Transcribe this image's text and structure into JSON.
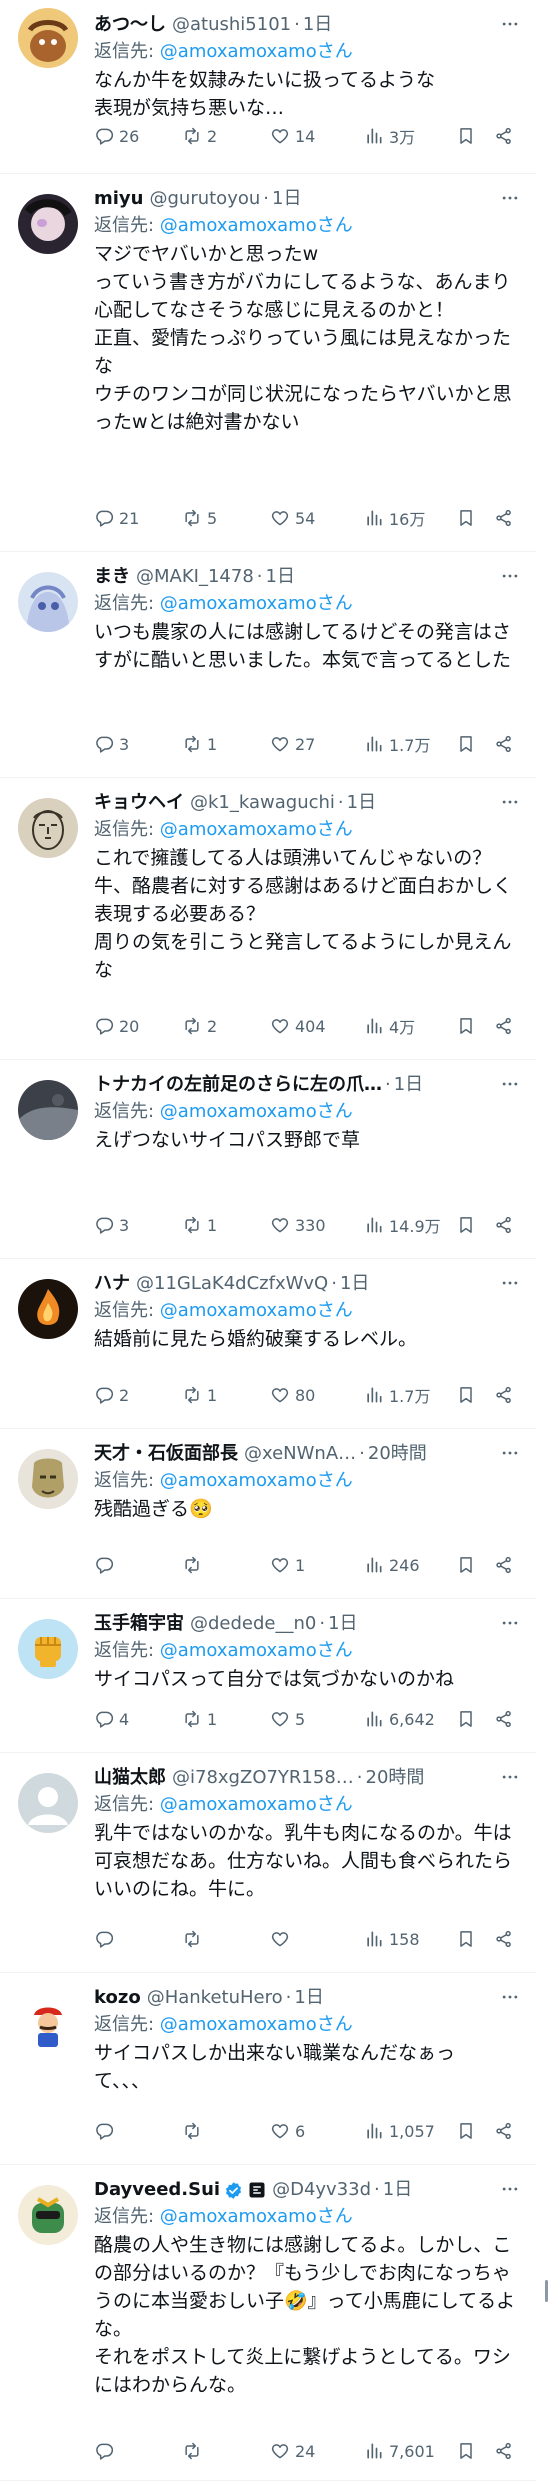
{
  "reply_prefix": "返信先: ",
  "reply_suffix": "さん",
  "tweets": [
    {
      "name": "あつ〜し",
      "handle": "@atushi5101",
      "time": "1日",
      "reply_to": "@amoxamoxamo",
      "text": "なんか牛を奴隷みたいに扱ってるような\n表現が気持ち悪いな…",
      "replies": "26",
      "retweets": "2",
      "likes": "14",
      "views": "3万",
      "avatar": {
        "kind": "illustration",
        "bg": "#f0c87a",
        "fg": "#a8642c"
      }
    },
    {
      "name": "miyu",
      "handle": "@gurutoyou",
      "time": "1日",
      "reply_to": "@amoxamoxamo",
      "text": "マジでヤバいかと思ったw\nっていう書き方がバカにしてるような、あんまり心配してなさそうな感じに見えるのかと！\n正直、愛情たっぷりっていう風には見えなかったな\nウチのワンコが同じ状況になったらヤバいかと思ったwとは絶対書かない",
      "replies": "21",
      "retweets": "5",
      "likes": "54",
      "views": "16万",
      "avatar": {
        "kind": "photo",
        "bg": "#2a2430",
        "fg": "#c9a0d6"
      }
    },
    {
      "name": "まき",
      "handle": "@MAKI_1478",
      "time": "1日",
      "reply_to": "@amoxamoxamo",
      "text": "いつも農家の人には感謝してるけどその発言はさすがに酷いと思いました。本気で言ってるとしたらSNS向いてないと思います。",
      "replies": "3",
      "retweets": "1",
      "likes": "27",
      "views": "1.7万",
      "avatar": {
        "kind": "anime",
        "bg": "#d8e4f2",
        "fg": "#4a5fa8"
      }
    },
    {
      "name": "キョウヘイ",
      "handle": "@k1_kawaguchi",
      "time": "1日",
      "reply_to": "@amoxamoxamo",
      "text": "これで擁護してる人は頭沸いてんじゃないの？\n牛、酪農者に対する感謝はあるけど面白おかしく表現する必要ある？\n周りの気を引こうと発言してるようにしか見えんな",
      "replies": "20",
      "retweets": "2",
      "likes": "404",
      "views": "4万",
      "avatar": {
        "kind": "face-sketch",
        "bg": "#d9d0bd",
        "fg": "#3a3328"
      }
    },
    {
      "name": "トナカイの左前足のさらに左の爪…",
      "handle": "",
      "time": "1日",
      "reply_to": "@amoxamoxamo",
      "text": "えげつないサイコパス野郎で草",
      "replies": "3",
      "retweets": "1",
      "likes": "330",
      "views": "14.9万",
      "avatar": {
        "kind": "dark",
        "bg": "#3c4048",
        "fg": "#7a808a"
      }
    },
    {
      "name": "ハナ",
      "handle": "@11GLaK4dCzfxWvQ",
      "time": "1日",
      "reply_to": "@amoxamoxamo",
      "text": "結婚前に見たら婚約破棄するレベル。",
      "replies": "2",
      "retweets": "1",
      "likes": "80",
      "views": "1.7万",
      "avatar": {
        "kind": "fire",
        "bg": "#1b120c",
        "fg": "#f08a24"
      }
    },
    {
      "name": "天才・石仮面部長",
      "handle": "@xeNWnA…",
      "time": "20時間",
      "reply_to": "@amoxamoxamo",
      "text": "残酷過ぎる🥺",
      "replies": "",
      "retweets": "",
      "likes": "1",
      "views": "246",
      "avatar": {
        "kind": "mask",
        "bg": "#e8e4dc",
        "fg": "#b0a068"
      }
    },
    {
      "name": "玉手箱宇宙",
      "handle": "@dedede__n0",
      "time": "1日",
      "reply_to": "@amoxamoxamo",
      "text": "サイコパスって自分では気づかないのかね",
      "replies": "4",
      "retweets": "1",
      "likes": "5",
      "views": "6,642",
      "avatar": {
        "kind": "fist",
        "bg": "#bde3f4",
        "fg": "#f2b42c"
      }
    },
    {
      "name": "山猫太郎",
      "handle": "@i78xgZO7YR158…",
      "time": "20時間",
      "reply_to": "@amoxamoxamo",
      "text": "乳牛ではないのかな。乳牛も肉になるのか。牛は可哀想だなあ。仕方ないね。人間も食べられたらいいのにね。牛に。",
      "replies": "",
      "retweets": "",
      "likes": "",
      "views": "158",
      "avatar": {
        "kind": "default",
        "bg": "#cfd9de",
        "fg": "#ffffff"
      }
    },
    {
      "name": "kozo",
      "handle": "@HanketuHero",
      "time": "1日",
      "reply_to": "@amoxamoxamo",
      "text": "サイコパスしか出来ない職業なんだなぁっ\nて、、、",
      "replies": "",
      "retweets": "",
      "likes": "6",
      "views": "1,057",
      "avatar": {
        "kind": "mario",
        "bg": "#ffffff",
        "fg": "#d8281c"
      }
    },
    {
      "name": "Dayveed.Sui",
      "handle": "@D4yv33d",
      "time": "1日",
      "reply_to": "@amoxamoxamo",
      "text": "酪農の人や生き物には感謝してるよ。しかし、この部分はいるのか？『もう少しでお肉になっちゃうのに本当愛おしい子🤣』って小馬鹿にしてるよな。\nそれをポストして炎上に繋げようとしてる。ワシにはわからんな。",
      "replies": "",
      "retweets": "",
      "likes": "24",
      "views": "7,601",
      "avatar": {
        "kind": "character",
        "bg": "#f2ecd8",
        "fg": "#3d8c4c"
      }
    }
  ],
  "colors": {
    "accent": "#1d9bf0",
    "secondary_text": "#536471",
    "primary_text": "#0f1419",
    "verified_badge": "#1d9bf0"
  },
  "icons": {
    "reply": "reply-icon",
    "retweet": "retweet-icon",
    "like": "heart-icon",
    "views": "analytics-icon",
    "bookmark": "bookmark-icon",
    "share": "share-icon",
    "more": "more-icon"
  }
}
